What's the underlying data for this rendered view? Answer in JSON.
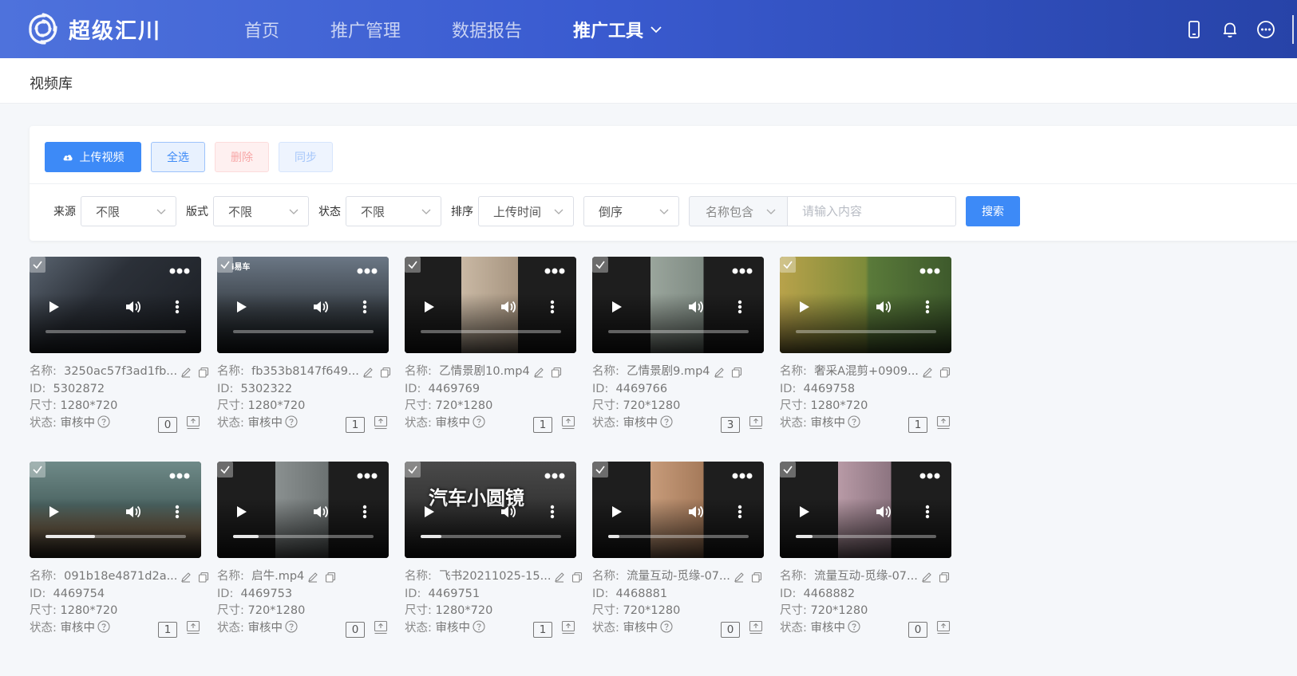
{
  "app": {
    "name": "超级汇川"
  },
  "nav": [
    {
      "label": "首页",
      "active": false
    },
    {
      "label": "推广管理",
      "active": false
    },
    {
      "label": "数据报告",
      "active": false
    },
    {
      "label": "推广工具",
      "active": true
    }
  ],
  "page": {
    "title": "视频库"
  },
  "toolbar": {
    "upload_label": "上传视频",
    "select_all_label": "全选",
    "delete_label": "删除",
    "sync_label": "同步"
  },
  "filters": {
    "source_label": "来源",
    "source_value": "不限",
    "format_label": "版式",
    "format_value": "不限",
    "status_label": "状态",
    "status_value": "不限",
    "sort_label": "排序",
    "sort_value": "上传时间",
    "order_value": "倒序",
    "name_mode": "名称包含",
    "search_placeholder": "请输入内容",
    "search_label": "搜索"
  },
  "labels": {
    "name": "名称:",
    "id": "ID:",
    "size": "尺寸:",
    "status": "状态:"
  },
  "videos": [
    {
      "name": "3250ac57f3ad1fb...",
      "id": "5302872",
      "size": "1280*720",
      "status": "审核中",
      "count": "0",
      "progress": 0.0,
      "overlay": ""
    },
    {
      "name": "fb353b8147f649...",
      "id": "5302322",
      "size": "1280*720",
      "status": "审核中",
      "count": "1",
      "progress": 0.0,
      "overlay": "i易车"
    },
    {
      "name": "乙情景剧10.mp4",
      "id": "4469769",
      "size": "720*1280",
      "status": "审核中",
      "count": "1",
      "progress": 0.0,
      "overlay": ""
    },
    {
      "name": "乙情景剧9.mp4",
      "id": "4469766",
      "size": "720*1280",
      "status": "审核中",
      "count": "3",
      "progress": 0.0,
      "overlay": ""
    },
    {
      "name": "奢采A混剪+0909...",
      "id": "4469758",
      "size": "1280*720",
      "status": "审核中",
      "count": "1",
      "progress": 0.0,
      "overlay": ""
    },
    {
      "name": "091b18e4871d2a...",
      "id": "4469754",
      "size": "1280*720",
      "status": "审核中",
      "count": "1",
      "progress": 0.35,
      "overlay": ""
    },
    {
      "name": "启牛.mp4",
      "id": "4469753",
      "size": "720*1280",
      "status": "审核中",
      "count": "0",
      "progress": 0.18,
      "overlay": ""
    },
    {
      "name": "飞书20211025-15...",
      "id": "4469751",
      "size": "1280*720",
      "status": "审核中",
      "count": "1",
      "progress": 0.15,
      "overlay": "汽车小圆镜"
    },
    {
      "name": "流量互动-觅缘-07...",
      "id": "4468881",
      "size": "720*1280",
      "status": "审核中",
      "count": "0",
      "progress": 0.08,
      "overlay": ""
    },
    {
      "name": "流量互动-觅缘-07...",
      "id": "4468882",
      "size": "720*1280",
      "status": "审核中",
      "count": "0",
      "progress": 0.12,
      "overlay": ""
    }
  ],
  "colors": {
    "primary": "#3d8af7",
    "header_start": "#4e72dc",
    "header_end": "#2743a8"
  }
}
